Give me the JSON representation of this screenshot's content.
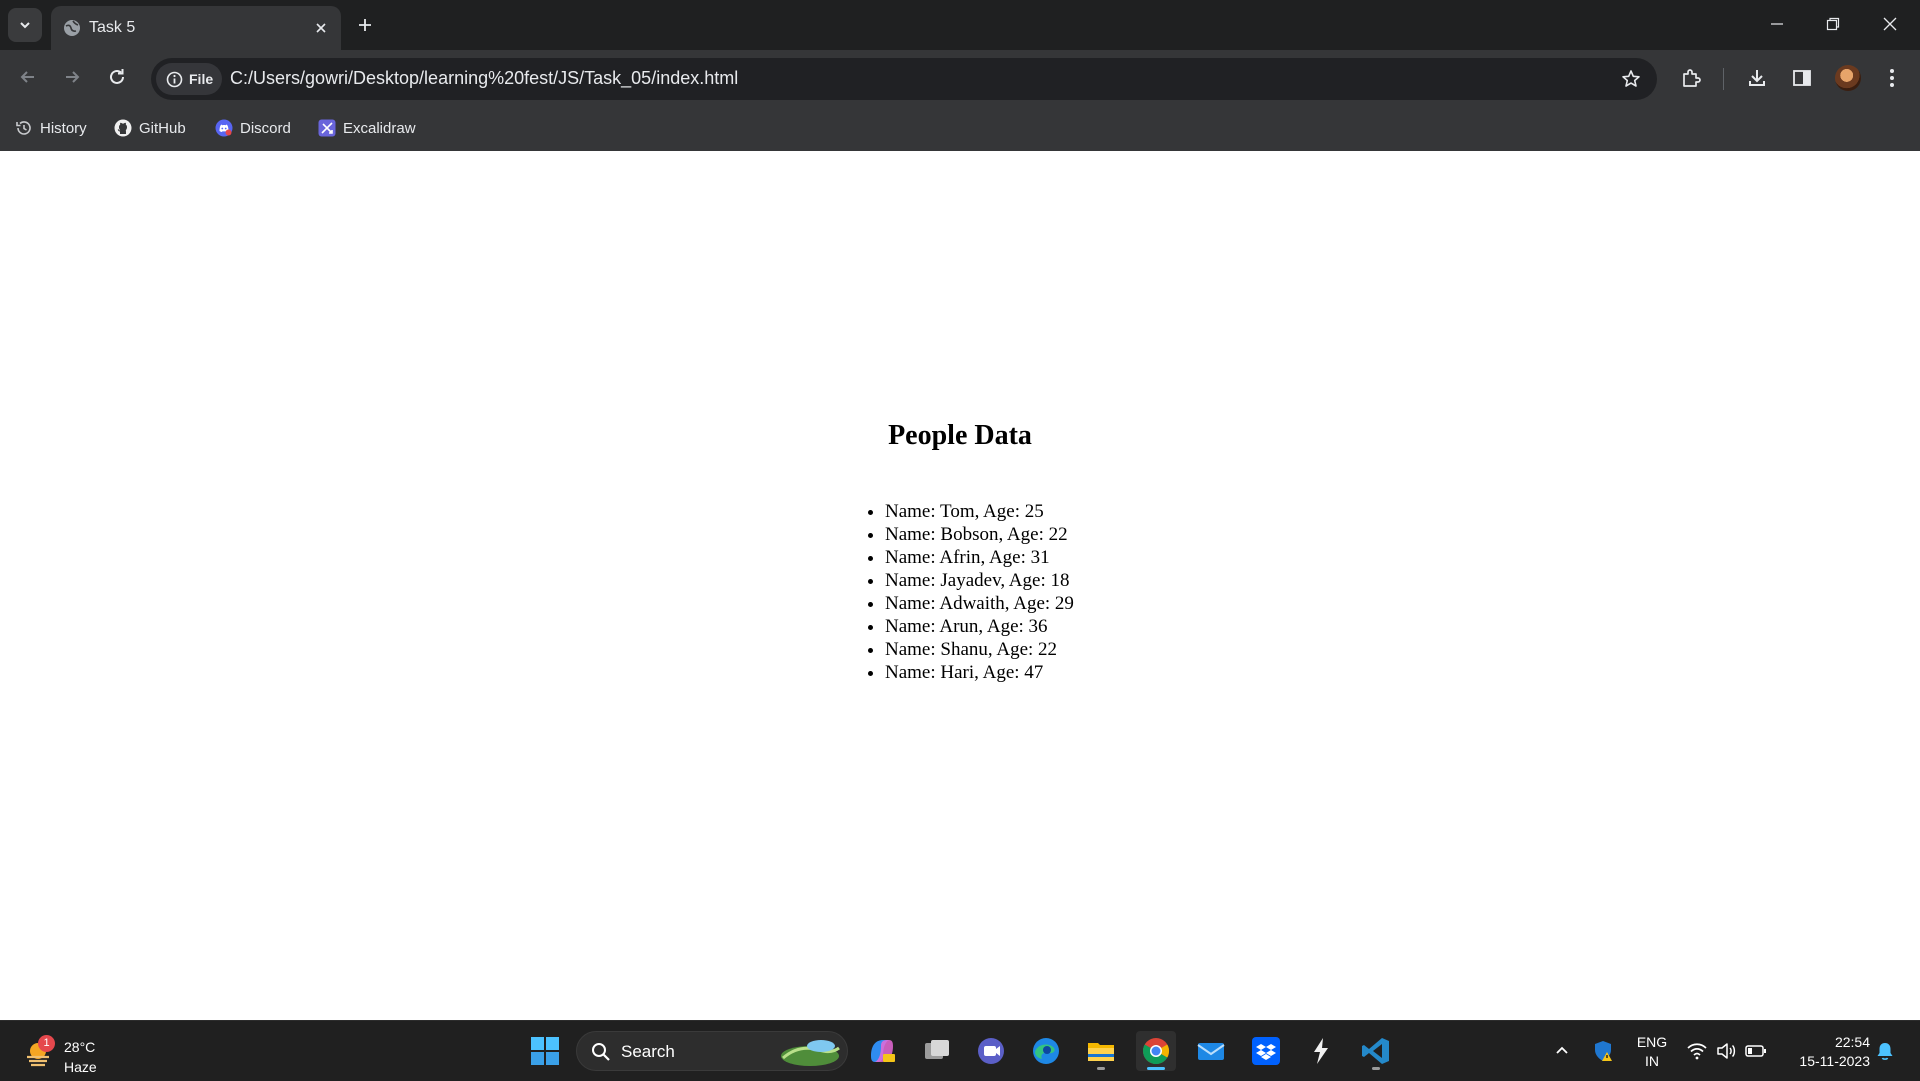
{
  "browser": {
    "tab_title": "Task 5",
    "address_chip": "File",
    "url": "C:/Users/gowri/Desktop/learning%20fest/JS/Task_05/index.html",
    "bookmarks": [
      {
        "label": "History",
        "icon": "history-icon"
      },
      {
        "label": "GitHub",
        "icon": "github-icon"
      },
      {
        "label": "Discord",
        "icon": "discord-icon"
      },
      {
        "label": "Excalidraw",
        "icon": "excalidraw-icon"
      }
    ]
  },
  "page": {
    "heading": "People Data",
    "people": [
      "Name: Tom, Age: 25",
      "Name: Bobson, Age: 22",
      "Name: Afrin, Age: 31",
      "Name: Jayadev, Age: 18",
      "Name: Adwaith, Age: 29",
      "Name: Arun, Age: 36",
      "Name: Shanu, Age: 22",
      "Name: Hari, Age: 47"
    ]
  },
  "taskbar": {
    "weather": {
      "temp": "28°C",
      "condition": "Haze",
      "badge": "1"
    },
    "search_label": "Search",
    "apps": [
      "start-icon",
      "search-icon",
      "copilot-icon",
      "task-view-icon",
      "teams-icon",
      "edge-icon",
      "file-explorer-icon",
      "chrome-icon",
      "mail-icon",
      "dropbox-icon",
      "lightning-app-icon",
      "vscode-icon"
    ],
    "language": {
      "line1": "ENG",
      "line2": "IN"
    },
    "time": "22:54",
    "date": "15-11-2023"
  },
  "colors": {
    "chrome_dark": "#1f2021",
    "chrome_toolbar": "#353638",
    "omnibox": "#202124",
    "taskbar": "#202020",
    "accent_blue": "#4cc2ff"
  }
}
